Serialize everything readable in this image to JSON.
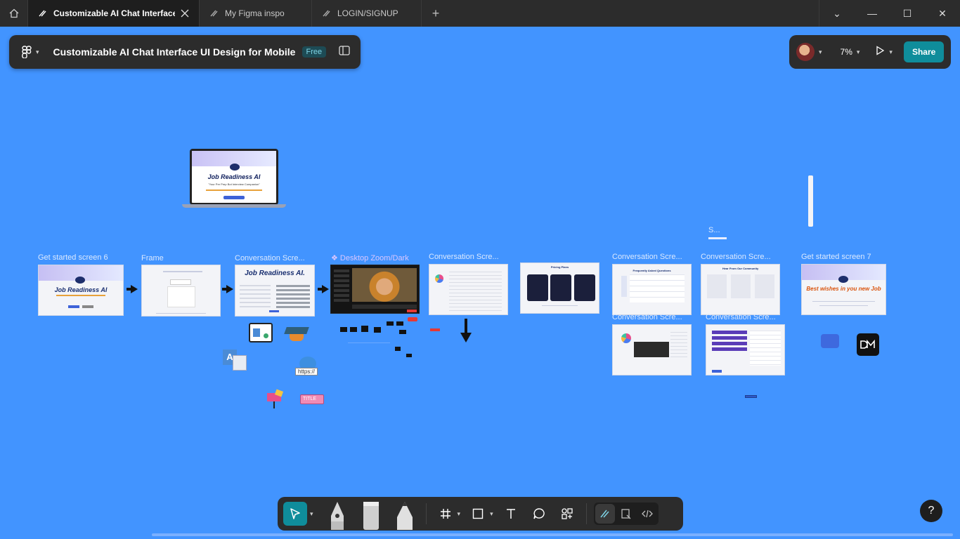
{
  "tabs": [
    {
      "label": "Customizable AI Chat Interface U",
      "active": true
    },
    {
      "label": "My Figma inspo",
      "active": false
    },
    {
      "label": "LOGIN/SIGNUP",
      "active": false
    }
  ],
  "file": {
    "title": "Customizable AI Chat Interface UI Design for Mobile a...",
    "plan_badge": "Free"
  },
  "header_right": {
    "zoom": "7%",
    "share_label": "Share"
  },
  "frames": {
    "f1": {
      "label": "Get started screen 6",
      "title": "Job Readiness AI"
    },
    "f2": {
      "label": "Frame"
    },
    "f3": {
      "label": "Conversation Scre...",
      "title": "Job Readiness AI."
    },
    "f4": {
      "label": "❖ Desktop Zoom/Dark"
    },
    "f5": {
      "label": "Conversation Scre..."
    },
    "f6": {
      "title": "Pricing Plans"
    },
    "f7": {
      "label": "Conversation Scre...",
      "title": "Frequently Asked Questions"
    },
    "f8": {
      "label": "Conversation Scre...",
      "title": "Hear From Our Community"
    },
    "f9": {
      "label": "Get started screen 7",
      "title": "Best wishes in you new Job"
    },
    "f10": {
      "label": "Conversation Scre..."
    },
    "f11": {
      "label": "Conversation Scre..."
    },
    "s_label": "S...",
    "laptop_title": "Job Readiness AI",
    "laptop_sub": "\"Your Pre Prep Bot Interview Companion\""
  },
  "stickers": {
    "https_label": "https://",
    "title_label": "TITLE",
    "translate_label": "A"
  },
  "help_label": "?"
}
